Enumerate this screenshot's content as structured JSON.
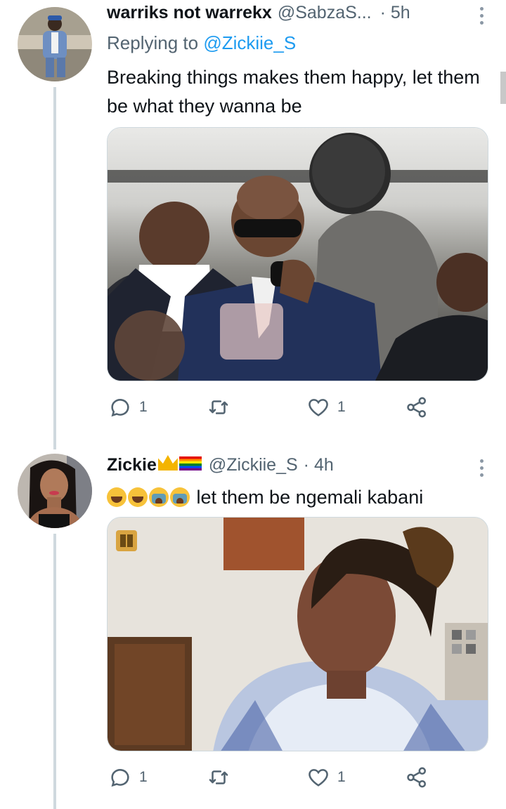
{
  "tweets": [
    {
      "display_name": "warriks not warrekx",
      "handle": "@SabzaS...",
      "time": "· 5h",
      "reply_prefix": "Replying to ",
      "reply_to": "@Zickiie_S",
      "text": "Breaking things makes them happy, let them be what they wanna be",
      "reply_count": "1",
      "retweet_count": "",
      "like_count": "1"
    },
    {
      "display_name": "Zickie",
      "handle": "@Zickiie_S",
      "time": "· 4h",
      "text": "let them be ngemali kabani",
      "reply_count": "1",
      "retweet_count": "",
      "like_count": "1"
    }
  ],
  "icons": {
    "reply": "reply-icon",
    "retweet": "retweet-icon",
    "like": "heart-icon",
    "share": "share-icon",
    "more": "more-vertical-icon"
  },
  "colors": {
    "link": "#1d9bf0",
    "secondary_text": "#536471",
    "thread_line": "#cfd9de"
  }
}
